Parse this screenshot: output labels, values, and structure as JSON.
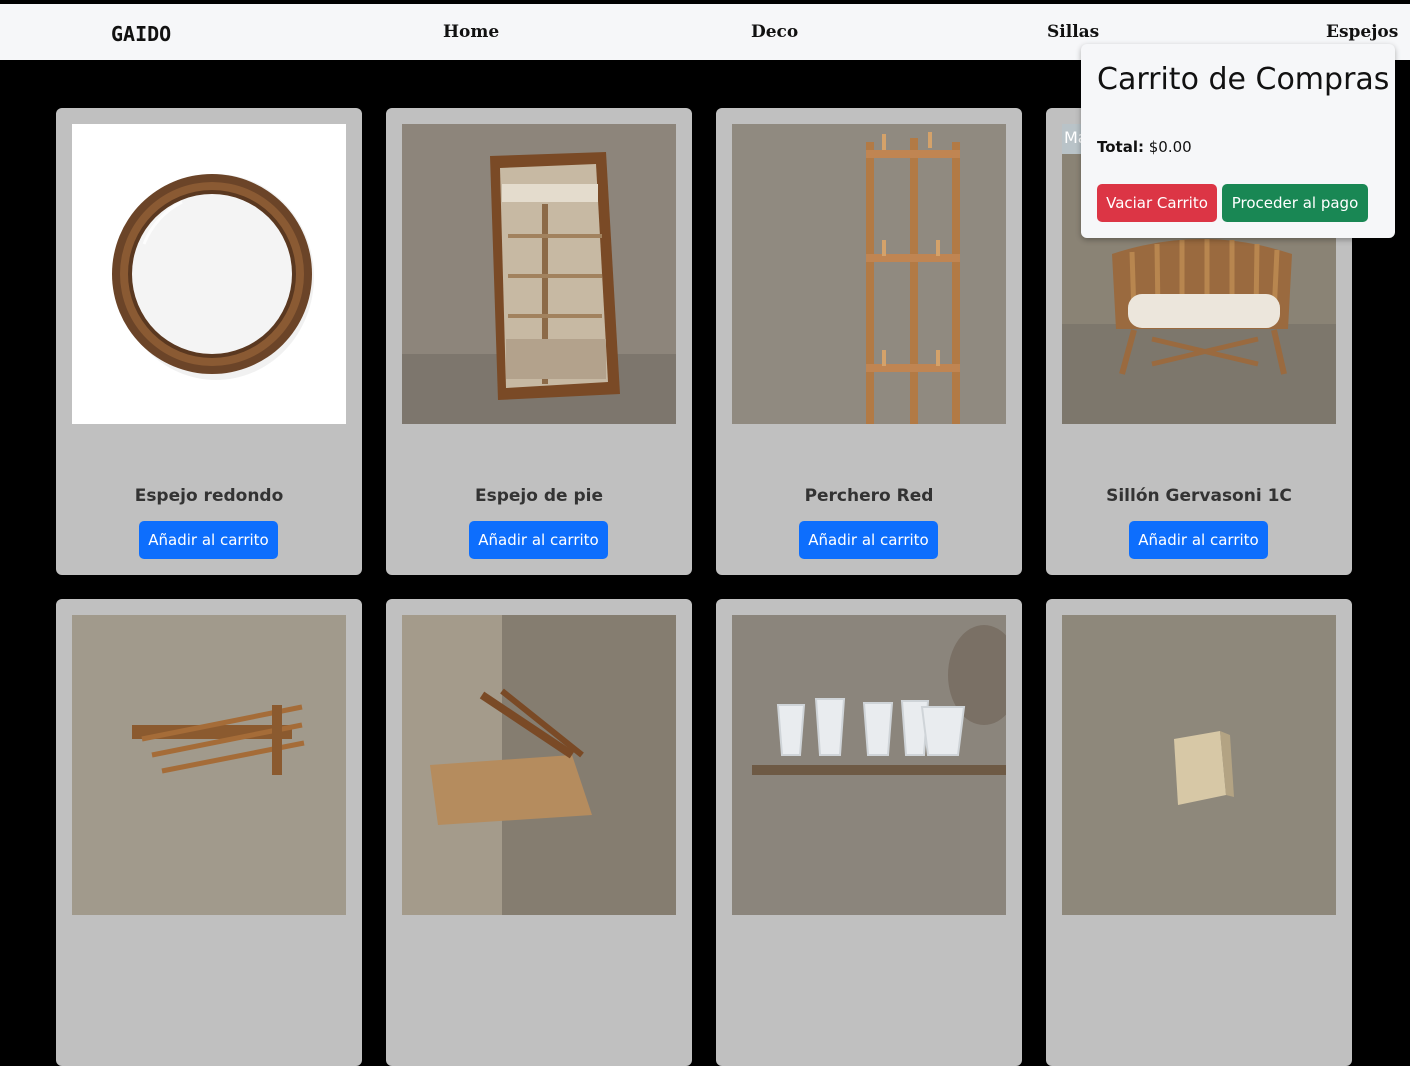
{
  "nav": {
    "brand": "GAIDO",
    "links": [
      "Home",
      "Deco",
      "Sillas",
      "Espejos"
    ]
  },
  "products": [
    {
      "title": "Espejo redondo",
      "button": "Añadir al carrito"
    },
    {
      "title": "Espejo de pie",
      "button": "Añadir al carrito"
    },
    {
      "title": "Perchero Red",
      "button": "Añadir al carrito"
    },
    {
      "title": "Sillón Gervasoni 1C",
      "button": "Añadir al carrito",
      "badge": "Má"
    },
    {
      "title": "",
      "button": ""
    },
    {
      "title": "",
      "button": ""
    },
    {
      "title": "",
      "button": ""
    },
    {
      "title": "",
      "button": ""
    }
  ],
  "cart": {
    "title": "Carrito de Compras",
    "total_label": "Total:",
    "total_value": "$0.00",
    "clear_label": "Vaciar Carrito",
    "pay_label": "Proceder al pago"
  },
  "colors": {
    "primary": "#0d6efd",
    "danger": "#dc3545",
    "success": "#198754",
    "card_bg": "#c0c0c0",
    "page_bg": "#000000"
  }
}
